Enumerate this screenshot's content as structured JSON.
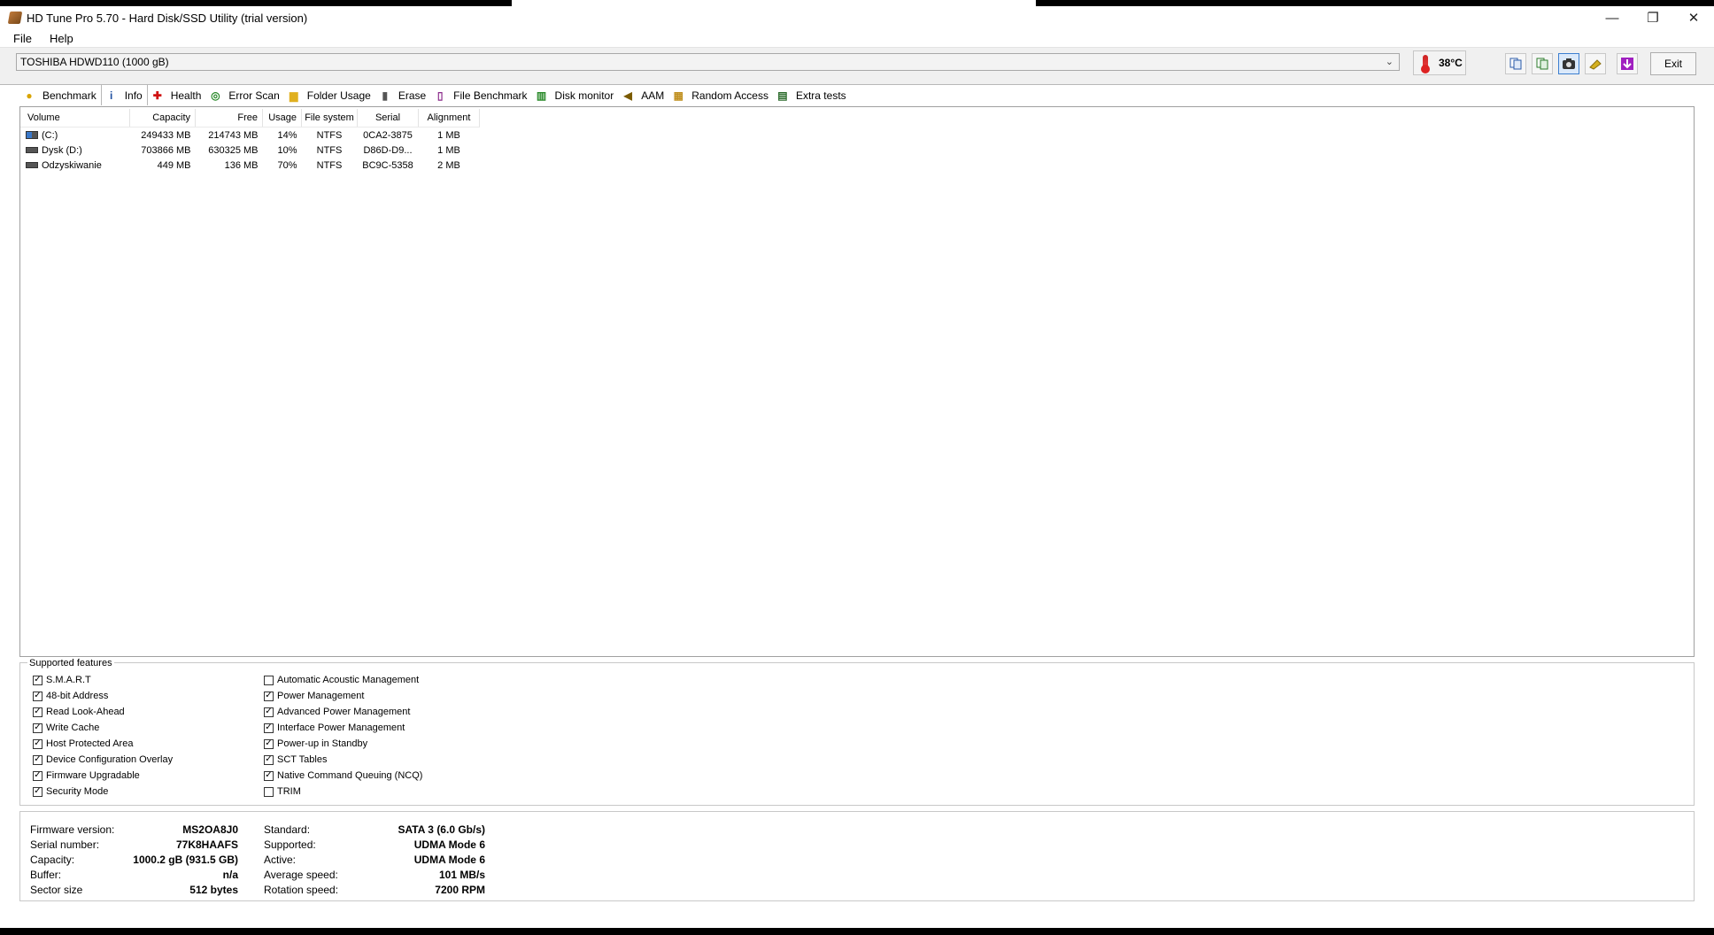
{
  "window": {
    "title": "HD Tune Pro 5.70 - Hard Disk/SSD Utility (trial version)",
    "controls": [
      "—",
      "❐",
      "✕"
    ]
  },
  "menu": [
    "File",
    "Help"
  ],
  "toolbar": {
    "drive": "TOSHIBA HDWD110 (1000 gB)",
    "temperature": "38°C",
    "exit_label": "Exit",
    "icons": [
      "copy-text-icon",
      "copy-info-icon",
      "screenshot-icon",
      "options-icon",
      "save-icon"
    ]
  },
  "tabs": [
    {
      "label": "Benchmark",
      "icon": "benchmark-icon",
      "glyph": "●",
      "color": "#d9a400"
    },
    {
      "label": "Info",
      "icon": "info-icon",
      "glyph": "i",
      "color": "#1f4fa0"
    },
    {
      "label": "Health",
      "icon": "health-icon",
      "glyph": "✚",
      "color": "#d01010"
    },
    {
      "label": "Error Scan",
      "icon": "error-scan-icon",
      "glyph": "◎",
      "color": "#2a8a2a"
    },
    {
      "label": "Folder Usage",
      "icon": "folder-icon",
      "glyph": "▆",
      "color": "#e0b020"
    },
    {
      "label": "Erase",
      "icon": "erase-icon",
      "glyph": "▮",
      "color": "#555555"
    },
    {
      "label": "File Benchmark",
      "icon": "file-benchmark-icon",
      "glyph": "▯",
      "color": "#8a2a8a"
    },
    {
      "label": "Disk monitor",
      "icon": "disk-monitor-icon",
      "glyph": "▥",
      "color": "#2a8a2a"
    },
    {
      "label": "AAM",
      "icon": "speaker-icon",
      "glyph": "◀",
      "color": "#7a5a00"
    },
    {
      "label": "Random Access",
      "icon": "random-access-icon",
      "glyph": "▦",
      "color": "#c09020"
    },
    {
      "label": "Extra tests",
      "icon": "extra-tests-icon",
      "glyph": "▤",
      "color": "#2a6a2a"
    }
  ],
  "active_tab": "Info",
  "volumes": {
    "headers": [
      "Volume",
      "Capacity",
      "Free",
      "Usage",
      "File system",
      "Serial",
      "Alignment"
    ],
    "rows": [
      {
        "volume": "(C:)",
        "capacity": "249433 MB",
        "free": "214743 MB",
        "usage": "14%",
        "fs": "NTFS",
        "serial": "0CA2-3875",
        "alignment": "1 MB"
      },
      {
        "volume": "Dysk (D:)",
        "capacity": "703866 MB",
        "free": "630325 MB",
        "usage": "10%",
        "fs": "NTFS",
        "serial": "D86D-D9...",
        "alignment": "1 MB"
      },
      {
        "volume": "Odzyskiwanie",
        "capacity": "449 MB",
        "free": "136 MB",
        "usage": "70%",
        "fs": "NTFS",
        "serial": "BC9C-5358",
        "alignment": "2 MB"
      }
    ]
  },
  "features": {
    "legend": "Supported features",
    "left": [
      {
        "label": "S.M.A.R.T",
        "checked": true
      },
      {
        "label": "48-bit Address",
        "checked": true
      },
      {
        "label": "Read Look-Ahead",
        "checked": true
      },
      {
        "label": "Write Cache",
        "checked": true
      },
      {
        "label": "Host Protected Area",
        "checked": true
      },
      {
        "label": "Device Configuration Overlay",
        "checked": true
      },
      {
        "label": "Firmware Upgradable",
        "checked": true
      },
      {
        "label": "Security Mode",
        "checked": true
      }
    ],
    "right": [
      {
        "label": "Automatic Acoustic Management",
        "checked": false
      },
      {
        "label": "Power Management",
        "checked": true
      },
      {
        "label": "Advanced Power Management",
        "checked": true
      },
      {
        "label": "Interface Power Management",
        "checked": true
      },
      {
        "label": "Power-up in Standby",
        "checked": true
      },
      {
        "label": "SCT Tables",
        "checked": true
      },
      {
        "label": "Native Command Queuing (NCQ)",
        "checked": true
      },
      {
        "label": "TRIM",
        "checked": false
      }
    ]
  },
  "info": {
    "left": [
      {
        "label": "Firmware version:",
        "value": "MS2OA8J0"
      },
      {
        "label": "Serial number:",
        "value": "77K8HAAFS"
      },
      {
        "label": "Capacity:",
        "value": "1000.2 gB (931.5 GB)"
      },
      {
        "label": "Buffer:",
        "value": "n/a"
      },
      {
        "label": "Sector size",
        "value": "512 bytes"
      }
    ],
    "right": [
      {
        "label": "Standard:",
        "value": "SATA 3 (6.0 Gb/s)"
      },
      {
        "label": "Supported:",
        "value": "UDMA Mode 6"
      },
      {
        "label": "Active:",
        "value": "UDMA Mode 6"
      },
      {
        "label": "Average speed:",
        "value": "101 MB/s"
      },
      {
        "label": "Rotation speed:",
        "value": "7200 RPM"
      }
    ]
  }
}
